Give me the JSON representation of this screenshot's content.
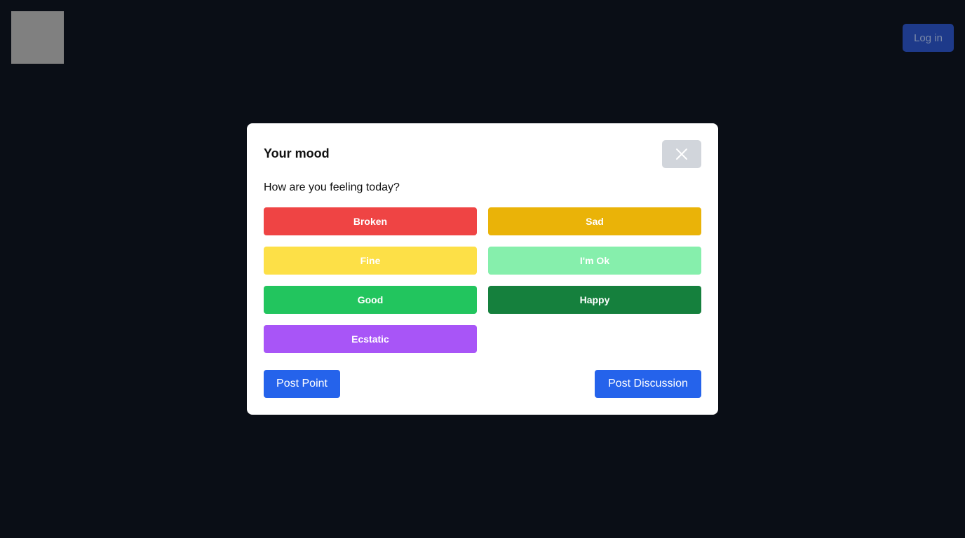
{
  "header": {
    "login_label": "Log in"
  },
  "modal": {
    "title": "Your mood",
    "question": "How are you feeling today?",
    "close_icon": "close-icon",
    "moods": [
      {
        "label": "Broken",
        "color": "#ef4444"
      },
      {
        "label": "Sad",
        "color": "#eab308"
      },
      {
        "label": "Fine",
        "color": "#fde047"
      },
      {
        "label": "I'm Ok",
        "color": "#86efac"
      },
      {
        "label": "Good",
        "color": "#22c55e"
      },
      {
        "label": "Happy",
        "color": "#15803d"
      },
      {
        "label": "Ecstatic",
        "color": "#a855f7"
      }
    ],
    "post_point_label": "Post Point",
    "post_discussion_label": "Post Discussion"
  },
  "colors": {
    "background": "#0a0e16",
    "accent": "#2563eb",
    "login_bg": "#1e3a8a"
  }
}
